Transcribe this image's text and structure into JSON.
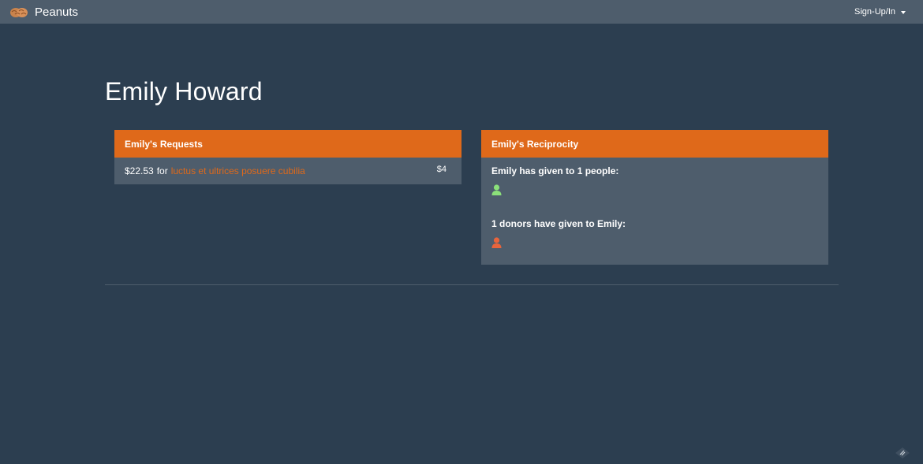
{
  "navbar": {
    "brand": "Peanuts",
    "menu_label": "Sign-Up/In"
  },
  "page": {
    "title": "Emily Howard"
  },
  "requests": {
    "heading": "Emily's Requests",
    "items": [
      {
        "amount": "$22.53",
        "for_text": "for",
        "link_text": "luctus et ultrices posuere cubilia",
        "badge": "$4"
      }
    ]
  },
  "reciprocity": {
    "heading": "Emily's Reciprocity",
    "given_label": "Emily has given to 1 people:",
    "received_label": "1 donors have given to Emily:",
    "given_icon": "user-icon",
    "received_icon": "user-icon"
  },
  "colors": {
    "background": "#2c3e50",
    "navbar": "#4e5d6c",
    "accent": "#df691a",
    "given_person": "#8be07a",
    "received_person": "#e8643c"
  }
}
